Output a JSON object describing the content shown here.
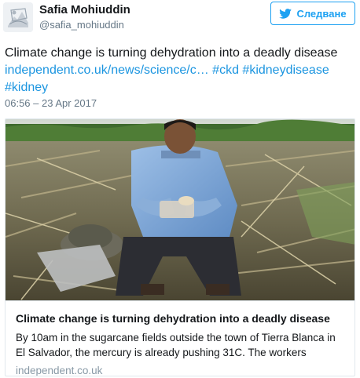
{
  "author": {
    "name": "Safia Mohiuddin",
    "handle": "@safia_mohiuddin"
  },
  "follow_button": {
    "label": "Следване",
    "icon": "twitter-bird-icon"
  },
  "tweet": {
    "line1": "Climate change is turning dehydration into a deadly disease",
    "link": "independent.co.uk/news/science/c…",
    "hashtags": [
      "#ckd",
      "#kidneydisease",
      "#kidney"
    ],
    "timestamp": "06:56 – 23 Apr 2017"
  },
  "card": {
    "title": "Climate change is turning dehydration into a deadly disease",
    "description": "By 10am in the sugarcane fields outside the town of Tierra Blanca in El Salvador, the mercury is already pushing 31C. The workers",
    "domain": "independent.co.uk"
  },
  "colors": {
    "link": "#1b95e0",
    "twitter_blue": "#1da1f2",
    "muted": "#657786"
  }
}
